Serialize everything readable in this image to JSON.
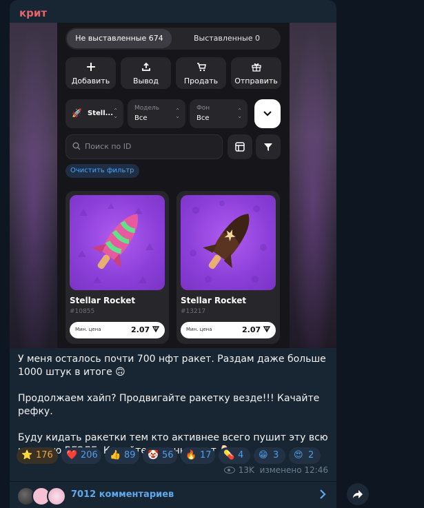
{
  "message": {
    "author": "крит",
    "paragraphs": [
      "У меня осталось почти 700 нфт ракет. Раздам даже больше 1000 штук в итоге 🙃",
      "Продолжаем хайп? Продвигайте ракетку везде!!! Качайте рефку.",
      "Буду кидать ракетки тем кто активнее всего пушит эту всю историю ВЕЗДЕ. Кидайте скрины в чат 👇🏻"
    ],
    "views": "13K",
    "edited": "изменено 12:46"
  },
  "screenshot": {
    "tabs": [
      "Не выставленные 674",
      "Выставленные 0"
    ],
    "actions": [
      {
        "label": "Добавить",
        "icon": "plus-icon"
      },
      {
        "label": "Вывод",
        "icon": "upload-icon"
      },
      {
        "label": "Продать",
        "icon": "cart-icon"
      },
      {
        "label": "Отправить",
        "icon": "send-gift-icon"
      }
    ],
    "filters": {
      "collection": "Stell...",
      "model_caption": "Модель",
      "model_value": "Все",
      "bg_caption": "Фон",
      "bg_value": "Все"
    },
    "search_placeholder": "Поиск по ID",
    "clear_filter": "Очистить фильтр",
    "cards": [
      {
        "name": "Stellar Rocket",
        "number": "#10855",
        "price_label": "Мин. цена",
        "price": "2.07"
      },
      {
        "name": "Stellar Rocket",
        "number": "#13217",
        "price_label": "Мин. цена",
        "price": "2.07"
      }
    ]
  },
  "reactions": [
    {
      "emoji": "⭐",
      "count": "176",
      "icon": "star-icon"
    },
    {
      "emoji": "❤️",
      "count": "206",
      "icon": "heart-icon"
    },
    {
      "emoji": "👍",
      "count": "89",
      "icon": "thumbs-up-icon"
    },
    {
      "emoji": "🤡",
      "count": "56",
      "icon": "clown-icon"
    },
    {
      "emoji": "🔥",
      "count": "17",
      "icon": "fire-icon"
    },
    {
      "emoji": "💊",
      "count": "4",
      "icon": "pill-icon"
    },
    {
      "emoji": "😁",
      "count": "3",
      "icon": "grin-icon"
    },
    {
      "emoji": "😍",
      "count": "2",
      "icon": "heart-eyes-icon"
    }
  ],
  "comments": {
    "label": "7012 комментариев"
  },
  "colors": {
    "background": "#0e1621",
    "bubble": "#182533",
    "author": "#e8646a",
    "link": "#5ea9ec",
    "card_art": "#9b4de6"
  }
}
